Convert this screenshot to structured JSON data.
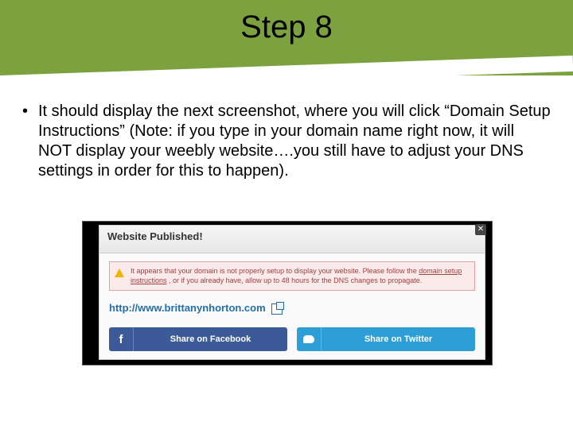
{
  "title": "Step 8",
  "bullet_dot": "•",
  "body": "It should display the next screenshot, where you will click “Domain Setup Instructions” (Note: if you type in your domain name right now, it will NOT display your weebly website….you still have to adjust your DNS settings in order for this to happen).",
  "shot": {
    "header": "Website Published!",
    "close": "✕",
    "alert_pre": "It appears that your domain is not properly setup to display your website. Please follow the ",
    "alert_link1": "domain setup instructions",
    "alert_mid": ", or if you already have, allow up to 48 hours for the DNS changes to propagate.",
    "url": "http://www.brittanynhorton.com",
    "fb_icon": "f",
    "fb": "Share on Facebook",
    "tw": "Share on Twitter"
  }
}
